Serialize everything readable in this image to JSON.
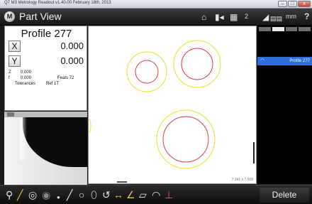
{
  "window": {
    "title": "Q7 M3 Metrology Readout  v1.40.00  February 18th, 2013",
    "min": "–",
    "max": "□",
    "close": "x"
  },
  "toolbar": {
    "logo": "M",
    "view_title": "Part View",
    "count": "2",
    "units": "mm",
    "help": "?"
  },
  "dro": {
    "profile": "Profile 277",
    "x_label": "X",
    "x_value": "0.000",
    "y_label": "Y",
    "y_value": "0.000",
    "z_label": "Z",
    "z_value": "0.000",
    "f_label": "f",
    "f_value": "0.000",
    "feats": "Feats 72",
    "tolerances": "Tolerances",
    "ref": "Ref 1T"
  },
  "partview": {
    "coords": "7.341 x 7.568"
  },
  "features": {
    "selected": "Profile 277"
  },
  "bottom": {
    "delete": "Delete"
  },
  "colors": {
    "selection": "#2d6fd8",
    "circle_outer": "#e6e22a",
    "circle_inner": "#e03c4c"
  }
}
